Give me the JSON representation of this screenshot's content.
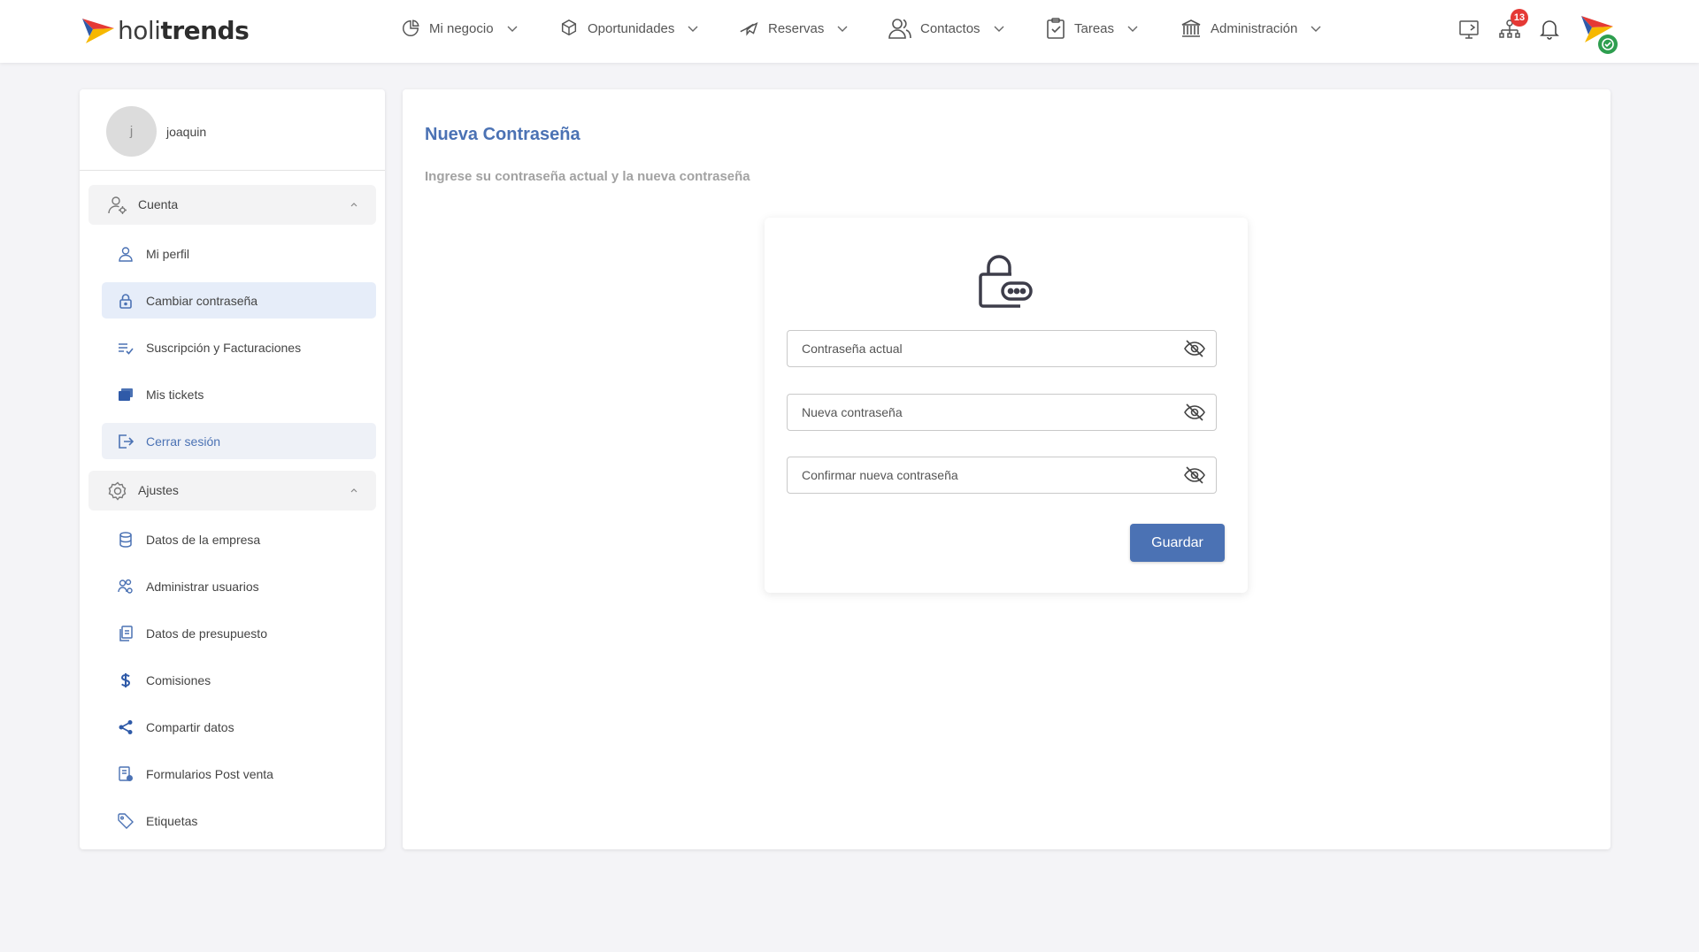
{
  "brand": {
    "name_light": "holi",
    "name_bold": "trends"
  },
  "nav": [
    {
      "label": "Mi negocio",
      "icon": "pie-chart-icon"
    },
    {
      "label": "Oportunidades",
      "icon": "box-icon"
    },
    {
      "label": "Reservas",
      "icon": "airplane-icon"
    },
    {
      "label": "Contactos",
      "icon": "users-icon"
    },
    {
      "label": "Tareas",
      "icon": "clipboard-icon"
    },
    {
      "label": "Administración",
      "icon": "bank-icon"
    }
  ],
  "toolbar": {
    "notifications_badge": "13"
  },
  "user": {
    "initial": "j",
    "name": "joaquin"
  },
  "sidebar": {
    "account": {
      "title": "Cuenta",
      "items": [
        {
          "label": "Mi perfil",
          "icon": "user-icon"
        },
        {
          "label": "Cambiar contraseña",
          "icon": "lock-icon"
        },
        {
          "label": "Suscripción y Facturaciones",
          "icon": "list-check-icon"
        },
        {
          "label": "Mis tickets",
          "icon": "tickets-icon"
        },
        {
          "label": "Cerrar sesión",
          "icon": "logout-icon"
        }
      ]
    },
    "settings": {
      "title": "Ajustes",
      "items": [
        {
          "label": "Datos de la empresa",
          "icon": "database-icon"
        },
        {
          "label": "Administrar usuarios",
          "icon": "users-gear-icon"
        },
        {
          "label": "Datos de presupuesto",
          "icon": "document-icon"
        },
        {
          "label": "Comisiones",
          "icon": "dollar-icon"
        },
        {
          "label": "Compartir datos",
          "icon": "share-icon"
        },
        {
          "label": "Formularios Post venta",
          "icon": "form-icon"
        },
        {
          "label": "Etiquetas",
          "icon": "tag-icon"
        }
      ]
    }
  },
  "page": {
    "title": "Nueva Contraseña",
    "subtitle": "Ingrese su contraseña actual y la nueva contraseña"
  },
  "form": {
    "current_password_placeholder": "Contraseña actual",
    "new_password_placeholder": "Nueva contraseña",
    "confirm_password_placeholder": "Confirmar nueva contraseña",
    "save_label": "Guardar"
  },
  "colors": {
    "accent": "#4b72b4",
    "badge": "#e53935",
    "online": "#2e9e4f"
  }
}
